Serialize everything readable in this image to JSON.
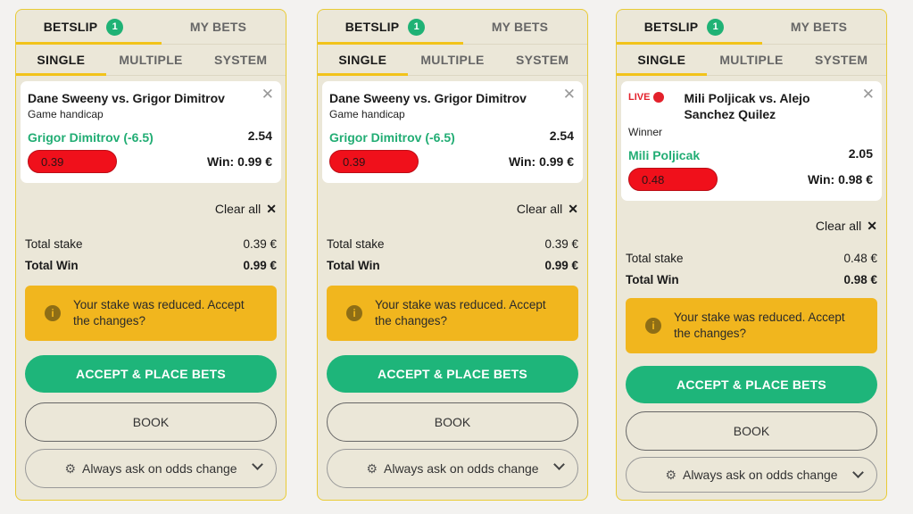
{
  "panels": [
    {
      "tabs_top": {
        "betslip": "BETSLIP",
        "badge": "1",
        "mybets": "MY BETS"
      },
      "tabs_sub": {
        "single": "SINGLE",
        "multiple": "MULTIPLE",
        "system": "SYSTEM"
      },
      "bet": {
        "match": "Dane Sweeny vs. Grigor Dimitrov",
        "market": "Game handicap",
        "selection": "Grigor Dimitrov (-6.5)",
        "odds": "2.54",
        "stake": "0.39",
        "win": "Win: 0.99 €"
      },
      "clear_all": "Clear all",
      "totals": {
        "stake_label": "Total stake",
        "stake_value": "0.39 €",
        "win_label": "Total Win",
        "win_value": "0.99 €"
      },
      "warning": "Your stake was reduced. Accept the changes?",
      "accept": "ACCEPT & PLACE BETS",
      "book": "BOOK",
      "odds_change": "Always ask on odds change"
    },
    {
      "tabs_top": {
        "betslip": "BETSLIP",
        "badge": "1",
        "mybets": "MY BETS"
      },
      "tabs_sub": {
        "single": "SINGLE",
        "multiple": "MULTIPLE",
        "system": "SYSTEM"
      },
      "bet": {
        "match": "Dane Sweeny vs. Grigor Dimitrov",
        "market": "Game handicap",
        "selection": "Grigor Dimitrov (-6.5)",
        "odds": "2.54",
        "stake": "0.39",
        "win": "Win: 0.99 €"
      },
      "clear_all": "Clear all",
      "totals": {
        "stake_label": "Total stake",
        "stake_value": "0.39 €",
        "win_label": "Total Win",
        "win_value": "0.99 €"
      },
      "warning": "Your stake was reduced. Accept the changes?",
      "accept": "ACCEPT & PLACE BETS",
      "book": "BOOK",
      "odds_change": "Always ask on odds change"
    },
    {
      "tabs_top": {
        "betslip": "BETSLIP",
        "badge": "1",
        "mybets": "MY BETS"
      },
      "tabs_sub": {
        "single": "SINGLE",
        "multiple": "MULTIPLE",
        "system": "SYSTEM"
      },
      "bet": {
        "live": "LIVE",
        "match": "Mili Poljicak vs. Alejo Sanchez Quilez",
        "market": "Winner",
        "selection": "Mili Poljicak",
        "odds": "2.05",
        "stake": "0.48",
        "win": "Win: 0.98 €"
      },
      "clear_all": "Clear all",
      "totals": {
        "stake_label": "Total stake",
        "stake_value": "0.48 €",
        "win_label": "Total Win",
        "win_value": "0.98 €"
      },
      "warning": "Your stake was reduced. Accept the changes?",
      "accept": "ACCEPT & PLACE BETS",
      "book": "BOOK",
      "odds_change": "Always ask on odds change"
    }
  ],
  "colors": {
    "accent_yellow": "#f2c31a",
    "green": "#1eb57a",
    "red_stake": "#f0101b",
    "warning": "#f1b61e"
  }
}
